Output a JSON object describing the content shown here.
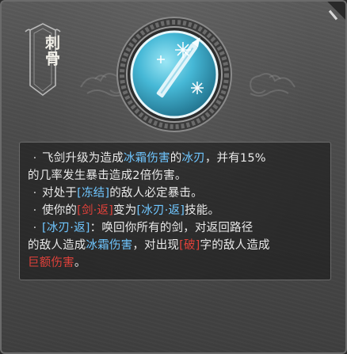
{
  "card": {
    "name": "刺骨",
    "colors": {
      "accent_blue": "#6fc6ff",
      "accent_red": "#e0413a",
      "text": "#e9e9e9",
      "emblem_orb": "#41b7d6"
    },
    "icon": "ice-sword-icon"
  },
  "description": {
    "lines": [
      {
        "bullet": "·",
        "parts": [
          {
            "text": "飞剑升级为造成",
            "color": "white"
          },
          {
            "text": "冰霜伤害",
            "color": "blue"
          },
          {
            "text": "的",
            "color": "white"
          },
          {
            "text": "冰刃",
            "color": "blue"
          },
          {
            "text": "，并有15%",
            "color": "white"
          }
        ]
      },
      {
        "bullet": "",
        "parts": [
          {
            "text": "的几率发生暴击造成2倍伤害。",
            "color": "white"
          }
        ]
      },
      {
        "bullet": "·",
        "parts": [
          {
            "text": "对处于",
            "color": "white"
          },
          {
            "text": "[冻结]",
            "color": "blue"
          },
          {
            "text": "的敌人必定暴击。",
            "color": "white"
          }
        ]
      },
      {
        "bullet": "·",
        "parts": [
          {
            "text": "使你的",
            "color": "white"
          },
          {
            "text": "[剑·返]",
            "color": "red"
          },
          {
            "text": "变为",
            "color": "white"
          },
          {
            "text": "[冰刃·返]",
            "color": "blue"
          },
          {
            "text": "技能。",
            "color": "white"
          }
        ]
      },
      {
        "bullet": "·",
        "parts": [
          {
            "text": "[冰刃·返]",
            "color": "blue"
          },
          {
            "text": "：唤回你所有的剑，对返回路径",
            "color": "white"
          }
        ]
      },
      {
        "bullet": "",
        "parts": [
          {
            "text": "的敌人造成",
            "color": "white"
          },
          {
            "text": "冰霜伤害",
            "color": "blue"
          },
          {
            "text": "，对出现",
            "color": "white"
          },
          {
            "text": "[破]",
            "color": "red"
          },
          {
            "text": "字的敌人造成",
            "color": "white"
          }
        ]
      },
      {
        "bullet": "",
        "parts": [
          {
            "text": "巨额伤害",
            "color": "red"
          },
          {
            "text": "。",
            "color": "white"
          }
        ]
      }
    ]
  }
}
